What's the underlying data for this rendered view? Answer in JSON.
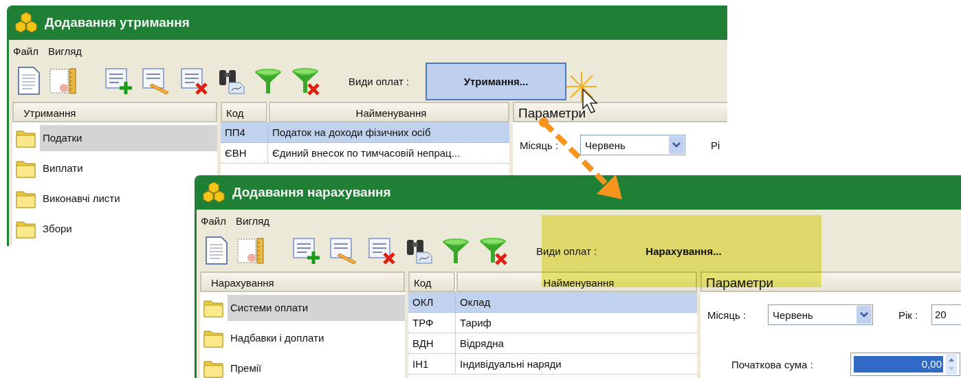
{
  "windows": [
    {
      "title": "Додавання утримання",
      "menu": [
        "Файл",
        "Вигляд"
      ],
      "pay_types": {
        "label": "Види оплат :",
        "value": "Утримання...",
        "active": true,
        "highlighted": false
      },
      "tree": {
        "header": "Утримання",
        "items": [
          {
            "label": "Податки",
            "selected": true
          },
          {
            "label": "Виплати",
            "selected": false
          },
          {
            "label": "Виконавчі листи",
            "selected": false
          },
          {
            "label": "Збори",
            "selected": false
          }
        ]
      },
      "table": {
        "columns": [
          "Код",
          "Найменування"
        ],
        "rows": [
          {
            "cells": [
              "ПП4",
              "Податок на доходи фізичних осіб"
            ],
            "selected": true
          },
          {
            "cells": [
              "ЄВН",
              "Єдиний внесок по тимчасовій непрац..."
            ],
            "selected": false
          }
        ]
      },
      "params": {
        "title": "Параметри",
        "month_label": "Місяць :",
        "month_value": "Червень",
        "year_label": "Рі"
      }
    },
    {
      "title": "Додавання нарахування",
      "menu": [
        "Файл",
        "Вигляд"
      ],
      "pay_types": {
        "label": "Види оплат :",
        "value": "Нарахування...",
        "active": false,
        "highlighted": true
      },
      "tree": {
        "header": "Нарахування",
        "items": [
          {
            "label": "Системи оплати",
            "selected": true
          },
          {
            "label": "Надбавки і доплати",
            "selected": false
          },
          {
            "label": "Премії",
            "selected": false
          }
        ]
      },
      "table": {
        "columns": [
          "Код",
          "Найменування"
        ],
        "rows": [
          {
            "cells": [
              "ОКЛ",
              "Оклад"
            ],
            "selected": true
          },
          {
            "cells": [
              "ТРФ",
              "Тариф"
            ],
            "selected": false
          },
          {
            "cells": [
              "ВДН",
              "Відрядна"
            ],
            "selected": false
          },
          {
            "cells": [
              "ІН1",
              "Індивідуальні наряди"
            ],
            "selected": false
          }
        ]
      },
      "params": {
        "title": "Параметри",
        "month_label": "Місяць :",
        "month_value": "Червень",
        "year_label": "Рік :",
        "year_value": "20",
        "start_sum_label": "Початкова сума :",
        "start_sum_value": "0,00"
      }
    }
  ]
}
